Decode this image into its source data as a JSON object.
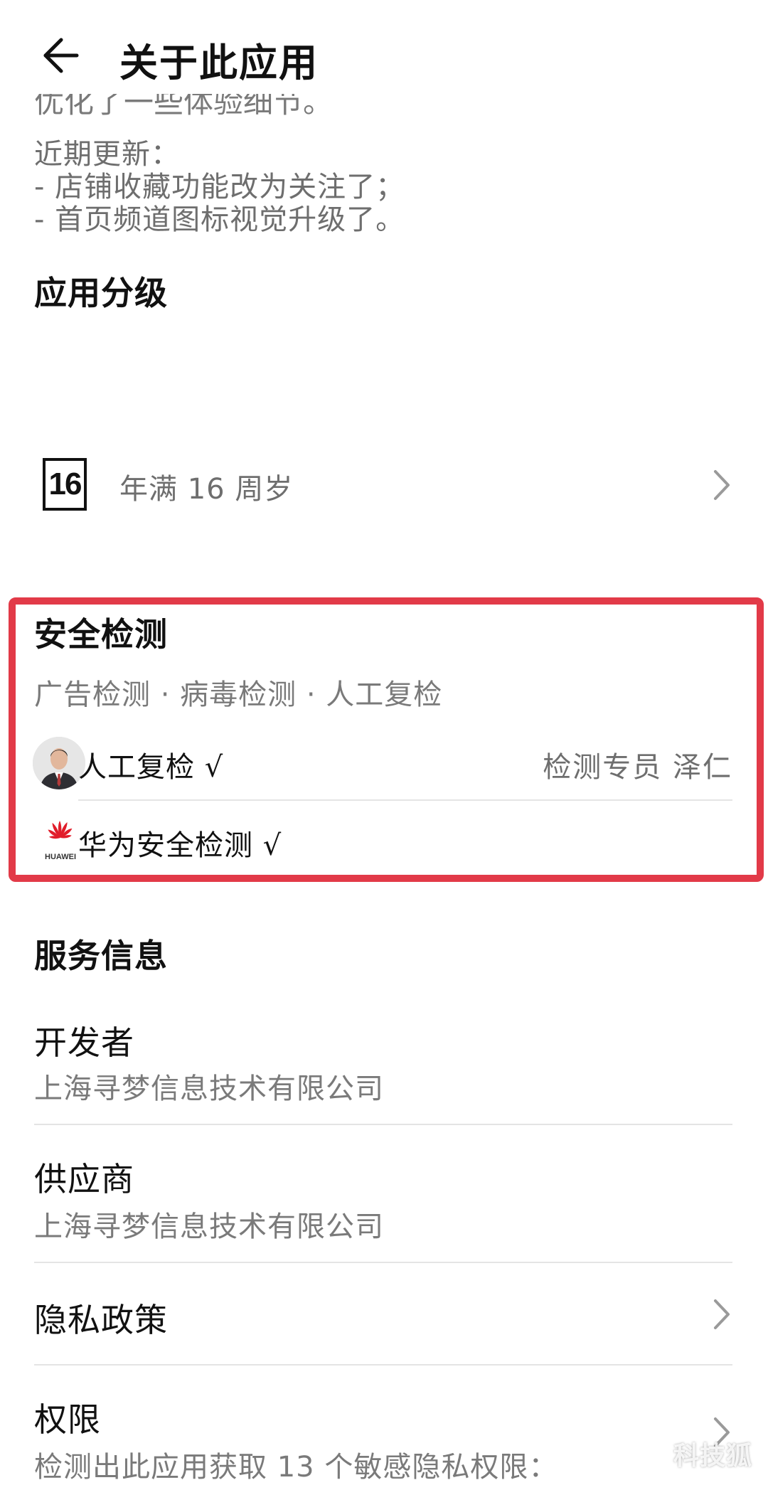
{
  "header": {
    "title": "关于此应用",
    "back_icon": "arrow-left-icon"
  },
  "description": {
    "clipped_line": "优化了一些体验细节。",
    "recent_updates_label": "近期更新：",
    "recent_updates": [
      "- 店铺收藏功能改为关注了；",
      "- 首页频道图标视觉升级了。"
    ]
  },
  "rating": {
    "heading": "应用分级",
    "badge": "16",
    "text": "年满 16 周岁",
    "chevron_icon": "chevron-right-icon"
  },
  "security": {
    "heading": "安全检测",
    "subtitle": "广告检测 · 病毒检测 · 人工复检",
    "manual_check": {
      "label": "人工复检 √",
      "inspector": "检测专员  泽仁",
      "avatar_icon": "person-avatar"
    },
    "huawei_check": {
      "label": "华为安全检测 √",
      "logo_icon": "huawei-logo",
      "logo_text": "HUAWEI"
    },
    "highlight_color": "#e23a48"
  },
  "service": {
    "heading": "服务信息",
    "developer": {
      "title": "开发者",
      "value": "上海寻梦信息技术有限公司"
    },
    "supplier": {
      "title": "供应商",
      "value": "上海寻梦信息技术有限公司"
    },
    "privacy": {
      "title": "隐私政策"
    },
    "permissions": {
      "title": "权限",
      "value": "检测出此应用获取 13 个敏感隐私权限："
    }
  },
  "watermark": "科技狐"
}
